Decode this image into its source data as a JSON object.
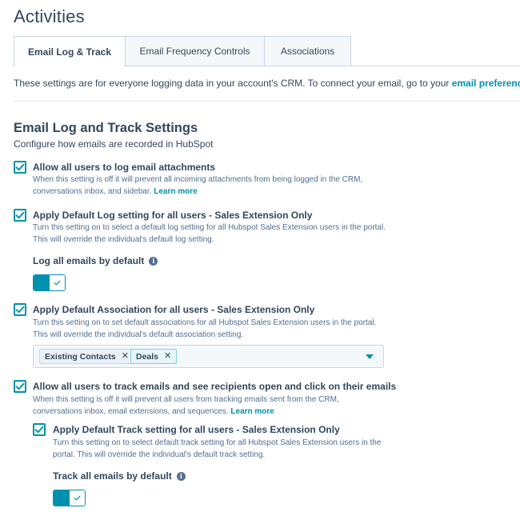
{
  "page": {
    "title": "Activities"
  },
  "tabs": [
    {
      "label": "Email Log & Track",
      "active": true
    },
    {
      "label": "Email Frequency Controls",
      "active": false
    },
    {
      "label": "Associations",
      "active": false
    }
  ],
  "intro": {
    "text": "These settings are for everyone logging data in your account's CRM. To connect your email, go to your ",
    "link": "email preferences",
    "suffix": "."
  },
  "section": {
    "title": "Email Log and Track Settings",
    "subtitle": "Configure how emails are recorded in HubSpot"
  },
  "options": {
    "attachments": {
      "checked": true,
      "label": "Allow all users to log email attachments",
      "help_line1": "When this setting is off it will prevent all incoming attachments from being logged in the CRM,",
      "help_line2": "conversations inbox, and sidebar. ",
      "help_link": "Learn more"
    },
    "default_log": {
      "checked": true,
      "label": "Apply Default Log setting for all users - Sales Extension Only",
      "help_line1": "Turn this setting on to select a default log setting for all Hubspot Sales Extension users in the portal.",
      "help_line2": "This will override the individual's default log setting.",
      "sub_label": "Log all emails by default",
      "toggle_on": true
    },
    "default_association": {
      "checked": true,
      "label": "Apply Default Association for all users - Sales Extension Only",
      "help_line1": "Turn this setting on to set default associations for all Hubspot Sales Extension users in the portal.",
      "help_line2": "This will override the individual's default association setting.",
      "tags": [
        "Existing Contacts",
        "Deals"
      ]
    },
    "track": {
      "checked": true,
      "label": "Allow all users to track emails and see recipients open and click on their emails",
      "help_line1": "When this setting is off it will prevent all users from tracking emails sent from the CRM,",
      "help_line2": "conversations inbox, email extensions, and sequences. ",
      "help_link": "Learn more"
    },
    "default_track": {
      "checked": true,
      "label": "Apply Default Track setting for all users - Sales Extension Only",
      "help_line1": "Turn this setting on to select default track setting for all Hubspot Sales Extension users in the",
      "help_line2": "portal. This will override the individual's default track setting.",
      "sub_label": "Track all emails by default",
      "toggle_on": true
    }
  },
  "icons": {
    "checkbox": "check-icon",
    "info": "info-icon",
    "remove": "close-icon",
    "dropdown": "caret-down-icon"
  },
  "colors": {
    "accent": "#0091ae",
    "text": "#33475b",
    "muted": "#516f90",
    "border": "#cbd6e2"
  }
}
